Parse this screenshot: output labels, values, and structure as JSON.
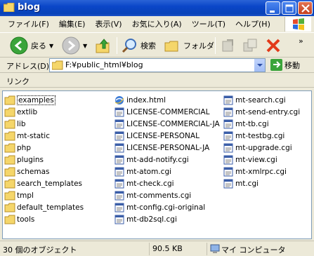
{
  "window": {
    "title": "blog"
  },
  "menu": [
    "ファイル(F)",
    "編集(E)",
    "表示(V)",
    "お気に入り(A)",
    "ツール(T)",
    "ヘルプ(H)"
  ],
  "toolbar": {
    "back_label": "戻る",
    "search_label": "検索",
    "folders_label": "フォルダ"
  },
  "address": {
    "label": "アドレス(D)",
    "value": "F:¥public_html¥blog",
    "go_label": "移動"
  },
  "links": {
    "label": "リンク"
  },
  "folders": [
    "examples",
    "extlib",
    "lib",
    "mt-static",
    "php",
    "plugins",
    "schemas",
    "search_templates",
    "tmpl",
    "default_templates",
    "tools"
  ],
  "files_col2": [
    "index.html",
    "LICENSE-COMMERCIAL",
    "LICENSE-COMMERCIAL-JA",
    "LICENSE-PERSONAL",
    "LICENSE-PERSONAL-JA",
    "mt-add-notify.cgi",
    "mt-atom.cgi",
    "mt-check.cgi",
    "mt-comments.cgi",
    "mt-config.cgi-original",
    "mt-db2sql.cgi"
  ],
  "files_col3": [
    "mt-search.cgi",
    "mt-send-entry.cgi",
    "mt-tb.cgi",
    "mt-testbg.cgi",
    "mt-upgrade.cgi",
    "mt-view.cgi",
    "mt-xmlrpc.cgi",
    "mt.cgi"
  ],
  "status": {
    "count": "30 個のオブジェクト",
    "size": "90.5 KB",
    "location": "マイ コンピュータ"
  },
  "colors": {
    "titlebar": "#0a46c8",
    "chrome": "#ece9d8",
    "folder": "#f5d66a",
    "link": "#0a46c8"
  }
}
